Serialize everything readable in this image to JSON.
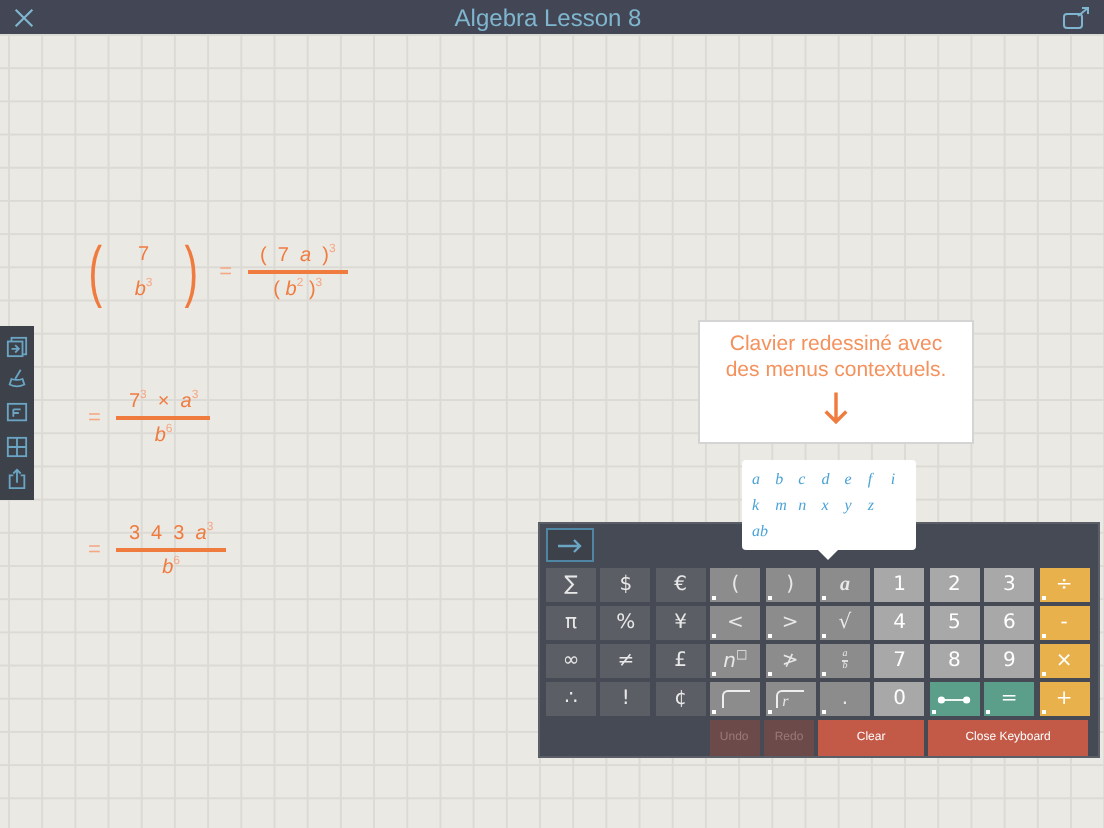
{
  "window": {
    "title": "Algebra Lesson 8"
  },
  "expressions": [
    {
      "kind": "paren",
      "lparen": "(",
      "rparen": ")",
      "num": "7",
      "den": "*b*$^{3}$",
      "equals": "=",
      "rnum": "(  7  *a*  )$^{3}$",
      "rden": "( *b*$^{2}$ )$^{3}$"
    },
    {
      "kind": "frac",
      "equals": "=",
      "num": "7$^{3}$  ×  *a*$^{3}$",
      "den": "*b*$^{6}$"
    },
    {
      "kind": "frac",
      "equals": "=",
      "num": "3  4  3  *a*$^{3}$",
      "den": "*b*$^{6}$"
    }
  ],
  "callout": {
    "text": "Clavier redessiné avec des menus contextuels."
  },
  "popup": {
    "rows": [
      [
        "a",
        "b",
        "c",
        "d",
        "e",
        "f",
        "i"
      ],
      [
        "k",
        "m",
        "n",
        "x",
        "y",
        "z"
      ],
      [
        "ab"
      ]
    ]
  },
  "keyboard": {
    "rows": [
      [
        {
          "label": "∑",
          "kind": "dark"
        },
        {
          "label": "$",
          "kind": "dark"
        },
        {
          "label": "€",
          "kind": "dark"
        },
        {
          "label": "(",
          "kind": "mid",
          "menu": true
        },
        {
          "label": ")",
          "kind": "mid",
          "menu": true
        },
        {
          "label": "a",
          "kind": "var",
          "menu": true
        },
        {
          "label": "1",
          "kind": "num"
        },
        {
          "label": "2",
          "kind": "num"
        },
        {
          "label": "3",
          "kind": "num"
        },
        {
          "label": "÷",
          "kind": "op",
          "menu": true
        }
      ],
      [
        {
          "label": "π",
          "kind": "dark"
        },
        {
          "label": "%",
          "kind": "dark"
        },
        {
          "label": "¥",
          "kind": "dark"
        },
        {
          "label": "<",
          "kind": "mid",
          "menu": true
        },
        {
          "label": ">",
          "kind": "mid",
          "menu": true
        },
        {
          "label": "√",
          "kind": "mid",
          "menu": true
        },
        {
          "label": "4",
          "kind": "num"
        },
        {
          "label": "5",
          "kind": "num"
        },
        {
          "label": "6",
          "kind": "num"
        },
        {
          "label": "-",
          "kind": "op",
          "menu": true
        }
      ],
      [
        {
          "label": "∞",
          "kind": "dark"
        },
        {
          "label": "≠",
          "kind": "dark"
        },
        {
          "label": "£",
          "kind": "dark"
        },
        {
          "label": "*n*$^{□}$",
          "kind": "mid",
          "menu": true
        },
        {
          "label": "≯",
          "kind": "mid",
          "menu": true
        },
        {
          "kind": "fraction",
          "num": "a",
          "den": "b",
          "menu": true
        },
        {
          "label": "7",
          "kind": "num"
        },
        {
          "label": "8",
          "kind": "num"
        },
        {
          "label": "9",
          "kind": "num"
        },
        {
          "label": "×",
          "kind": "op",
          "menu": true
        }
      ],
      [
        {
          "label": "∴",
          "kind": "dark"
        },
        {
          "label": "!",
          "kind": "dark"
        },
        {
          "label": "¢",
          "kind": "dark"
        },
        {
          "kind": "longdiv",
          "menu": true
        },
        {
          "label": "r",
          "kind": "longdiv",
          "menu": true
        },
        {
          "label": ".",
          "kind": "mid",
          "menu": true
        },
        {
          "label": "0",
          "kind": "num"
        },
        {
          "kind": "segment",
          "menu": true
        },
        {
          "label": "=",
          "kind": "green",
          "menu": true
        },
        {
          "label": "+",
          "kind": "op",
          "menu": true
        }
      ]
    ],
    "actions": [
      {
        "label": "Undo",
        "disabled": true
      },
      {
        "label": "Redo",
        "disabled": true
      },
      {
        "label": "Clear",
        "disabled": false
      },
      {
        "label": "Close Keyboard",
        "disabled": false
      }
    ]
  }
}
